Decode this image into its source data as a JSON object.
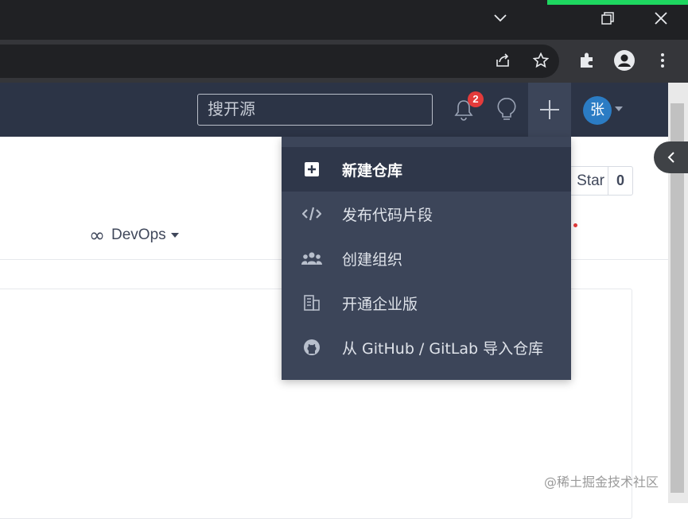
{
  "search": {
    "placeholder": "搜开源"
  },
  "notifications": {
    "count": "2"
  },
  "user": {
    "avatar_text": "张"
  },
  "repo": {
    "star_label": "Star",
    "star_count": "0",
    "devops_label": "DevOps"
  },
  "dropdown": {
    "items": [
      {
        "label": "新建仓库",
        "icon": "plus-square-icon"
      },
      {
        "label": "发布代码片段",
        "icon": "code-icon"
      },
      {
        "label": "创建组织",
        "icon": "users-icon"
      },
      {
        "label": "开通企业版",
        "icon": "building-icon"
      },
      {
        "label": "从 GitHub / GitLab 导入仓库",
        "icon": "github-icon"
      }
    ]
  },
  "watermark": "@稀土掘金技术社区",
  "colors": {
    "nav_bg": "#2c3446",
    "dropdown_bg": "#3c4559",
    "badge": "#e43b3b",
    "avatar": "#2b7cc4",
    "accent": "#1ed760"
  }
}
